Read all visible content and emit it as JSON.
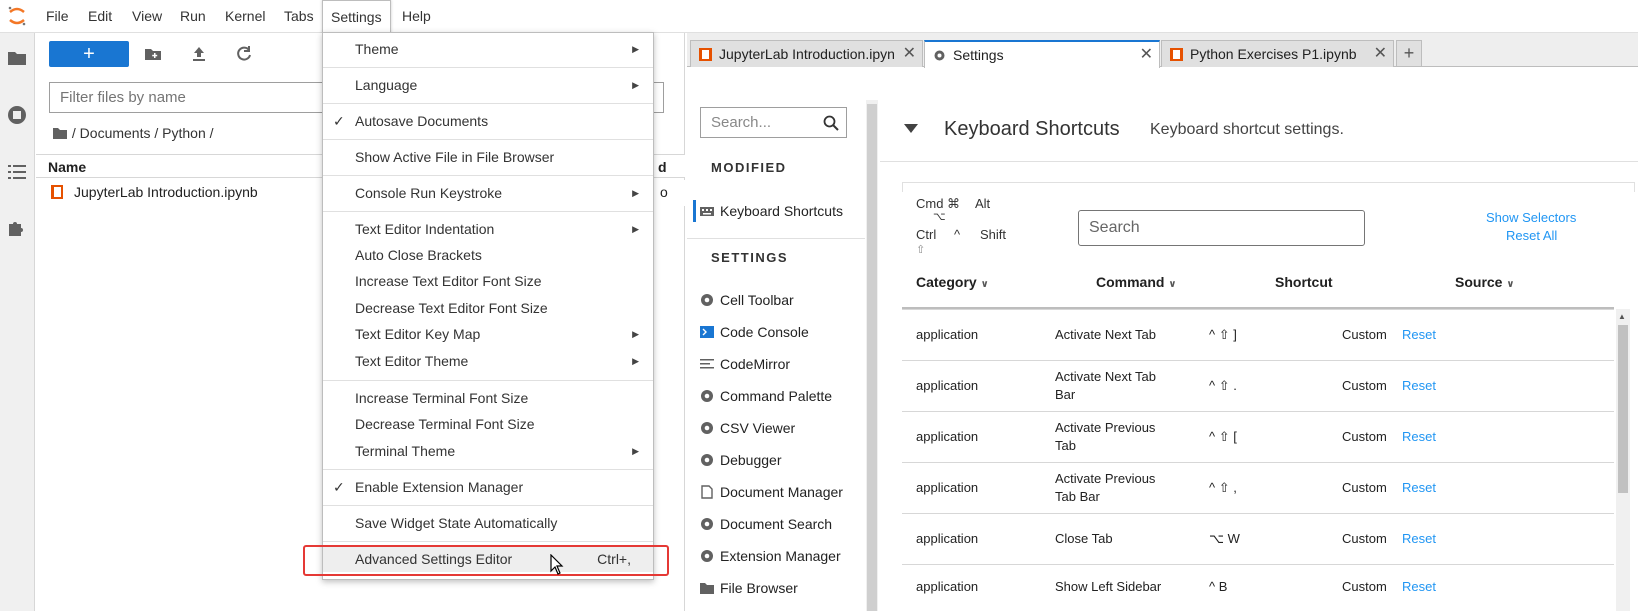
{
  "menubar": {
    "items": [
      "File",
      "Edit",
      "View",
      "Run",
      "Kernel",
      "Tabs",
      "Settings",
      "Help"
    ]
  },
  "filebrowser": {
    "filter_placeholder": "Filter files by name",
    "breadcrumb": "/ Documents / Python /",
    "header_name": "Name",
    "header_modified_partial": "d",
    "file_name": "JupyterLab Introduction.ipynb",
    "file_modified_partial": "o"
  },
  "tabs": [
    {
      "label": "JupyterLab Introduction.ipyn"
    },
    {
      "label": "Settings"
    },
    {
      "label": "Python Exercises P1.ipynb"
    }
  ],
  "settings_sidebar": {
    "search_placeholder": "Search...",
    "modified_head": "MODIFIED",
    "modified_item": "Keyboard Shortcuts",
    "settings_head": "SETTINGS",
    "items": [
      "Cell Toolbar",
      "Code Console",
      "CodeMirror",
      "Command Palette",
      "CSV Viewer",
      "Debugger",
      "Document Manager",
      "Document Search",
      "Extension Manager",
      "File Browser"
    ]
  },
  "shortcut_panel": {
    "title": "Keyboard Shortcuts",
    "description": "Keyboard shortcut settings.",
    "legend": {
      "cmd": "Cmd ⌘",
      "alt": "Alt",
      "opt": "⌥",
      "ctrl": "Ctrl",
      "caret": "^",
      "shift": "Shift",
      "shift_sym": "⇧"
    },
    "search_placeholder": "Search",
    "show_selectors": "Show Selectors",
    "reset_all": "Reset All",
    "columns": [
      "Category",
      "Command",
      "Shortcut",
      "Source"
    ],
    "rows": [
      {
        "category": "application",
        "command": [
          "Activate Next Tab",
          ""
        ],
        "shortcut": "^ ⇧ ]",
        "source": "Custom",
        "action": "Reset"
      },
      {
        "category": "application",
        "command": [
          "Activate Next Tab",
          "Bar"
        ],
        "shortcut": "^ ⇧ .",
        "source": "Custom",
        "action": "Reset"
      },
      {
        "category": "application",
        "command": [
          "Activate Previous",
          "Tab"
        ],
        "shortcut": "^ ⇧ [",
        "source": "Custom",
        "action": "Reset"
      },
      {
        "category": "application",
        "command": [
          "Activate Previous",
          "Tab Bar"
        ],
        "shortcut": "^ ⇧ ,",
        "source": "Custom",
        "action": "Reset"
      },
      {
        "category": "application",
        "command": [
          "Close Tab",
          ""
        ],
        "shortcut": "⌥ W",
        "source": "Custom",
        "action": "Reset"
      },
      {
        "category": "application",
        "command": [
          "Show Left Sidebar",
          ""
        ],
        "shortcut": "^ B",
        "source": "Custom",
        "action": "Reset"
      }
    ]
  },
  "settings_menu": {
    "items": [
      {
        "label": "Theme",
        "submenu": true
      },
      {
        "label": "Language",
        "submenu": true
      },
      {
        "label": "Autosave Documents",
        "checked": true
      },
      {
        "label": "Show Active File in File Browser"
      },
      {
        "label": "Console Run Keystroke",
        "submenu": true
      },
      {
        "label": "Text Editor Indentation",
        "submenu": true
      },
      {
        "label": "Auto Close Brackets"
      },
      {
        "label": "Increase Text Editor Font Size"
      },
      {
        "label": "Decrease Text Editor Font Size"
      },
      {
        "label": "Text Editor Key Map",
        "submenu": true
      },
      {
        "label": "Text Editor Theme",
        "submenu": true
      },
      {
        "label": "Increase Terminal Font Size"
      },
      {
        "label": "Decrease Terminal Font Size"
      },
      {
        "label": "Terminal Theme",
        "submenu": true
      },
      {
        "label": "Enable Extension Manager",
        "checked": true
      },
      {
        "label": "Save Widget State Automatically"
      },
      {
        "label": "Advanced Settings Editor",
        "shortcut": "Ctrl+,"
      }
    ]
  },
  "colors": {
    "accent": "#1976d2",
    "notebook_icon": "#e65100",
    "highlight": "#e53935",
    "link": "#2196f3"
  }
}
